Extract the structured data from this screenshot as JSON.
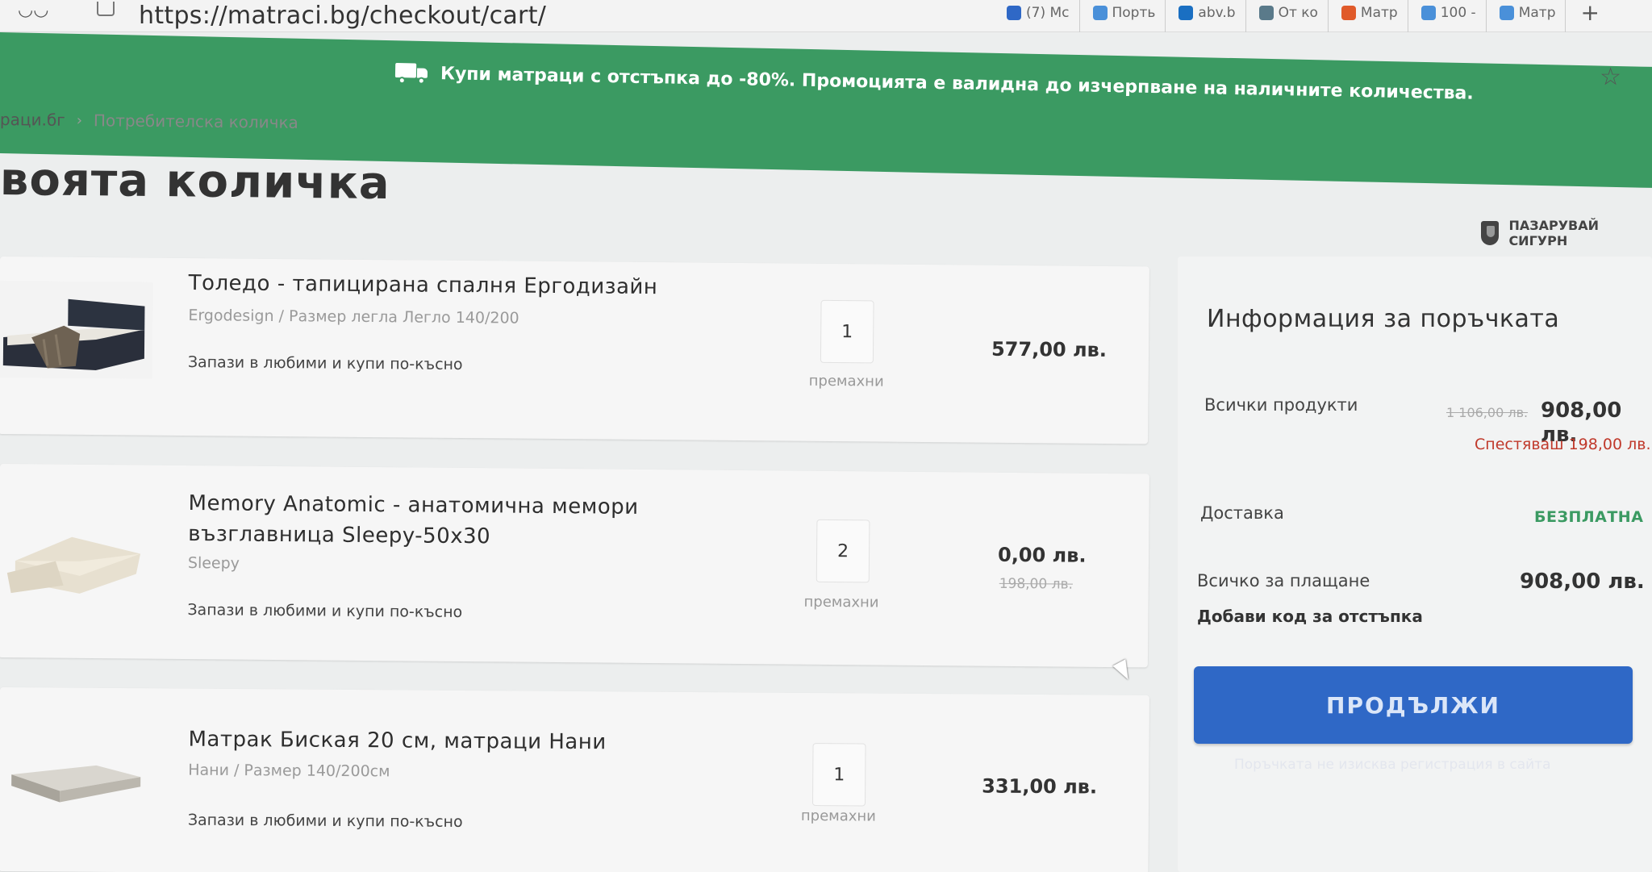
{
  "browser": {
    "url": "https://matraci.bg/checkout/cart/",
    "tabs": [
      {
        "label": "(7) Mc",
        "color": "#2f68c6"
      },
      {
        "label": "Порть",
        "color": "#4a90d9"
      },
      {
        "label": "abv.b",
        "color": "#1a6fc2"
      },
      {
        "label": "От ко",
        "color": "#5a7a8a"
      },
      {
        "label": "Матр",
        "color": "#e05a2a"
      },
      {
        "label": "100 -",
        "color": "#4a90d9"
      },
      {
        "label": "Матр",
        "color": "#4a90d9"
      }
    ],
    "new_tab_label": "+"
  },
  "promo": {
    "text": "Купи матраци с отстъпка до -80%. Промоцията е валидна до изчерпване на наличните количества."
  },
  "breadcrumb": {
    "home": "раци.бг",
    "separator": "›",
    "current": "Потребителска количка"
  },
  "page_title": "воята количка",
  "secure_label": "ПАЗАРУВАЙ СИГУРН",
  "cart": {
    "items": [
      {
        "title": "Толедо - тапицирана спалня Ергодизайн",
        "subtitle": "Ergodesign / Размер легла Легло 140/200",
        "fav_link": "Запази в любими и купи по-късно",
        "quantity": "1",
        "remove_label": "премахни",
        "price": "577,00 лв.",
        "old_price": ""
      },
      {
        "title": "Memory Anatomic - анатомична мемори възглавница Sleepy-50x30",
        "subtitle": "Sleepy",
        "fav_link": "Запази в любими и купи по-късно",
        "quantity": "2",
        "remove_label": "премахни",
        "price": "0,00 лв.",
        "old_price": "198,00 лв."
      },
      {
        "title": "Матрак Биская 20 см, матраци Нани",
        "subtitle": "Нани / Размер 140/200см",
        "fav_link": "Запази в любими и купи по-късно",
        "quantity": "1",
        "remove_label": "премахни",
        "price": "331,00 лв.",
        "old_price": ""
      }
    ]
  },
  "summary": {
    "title": "Информация за поръчката",
    "all_products_label": "Всички продукти",
    "all_products_old": "1 106,00 лв.",
    "all_products_value": "908,00 лв.",
    "savings": "Спестяваш 198,00 лв.",
    "delivery_label": "Доставка",
    "delivery_value": "БЕЗПЛАТНА",
    "total_label": "Всичко за плащане",
    "total_value": "908,00 лв.",
    "discount_link": "Добави код за отстъпка",
    "continue_label": "ПРОДЪЛЖИ",
    "no_registration_note": "Поръчката не изисква регистрация в сайта"
  },
  "colors": {
    "promo_green": "#3b9a62",
    "button_blue": "#2f68c6",
    "savings_red": "#c0392b"
  }
}
